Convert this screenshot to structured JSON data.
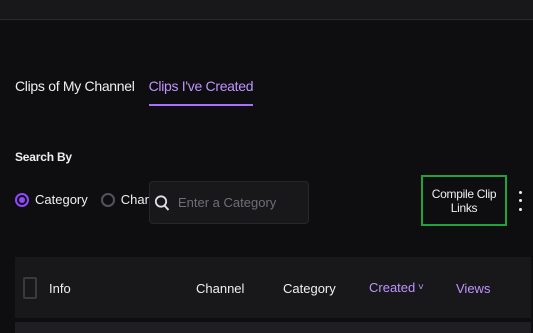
{
  "tabs": [
    {
      "label": "Clips of My Channel"
    },
    {
      "label": "Clips I've Created"
    }
  ],
  "search": {
    "title": "Search By",
    "options": [
      {
        "label": "Category"
      },
      {
        "label": "Channel"
      }
    ],
    "placeholder": "Enter a Category"
  },
  "actions": {
    "compile_label": "Compile Clip Links"
  },
  "table": {
    "columns": [
      "Info",
      "Channel",
      "Category",
      "Created",
      "Views"
    ],
    "sort_indicator": "˅"
  },
  "colors": {
    "accent": "#a970ff",
    "compile_border": "#1fa33c",
    "background": "#0e0e10"
  }
}
